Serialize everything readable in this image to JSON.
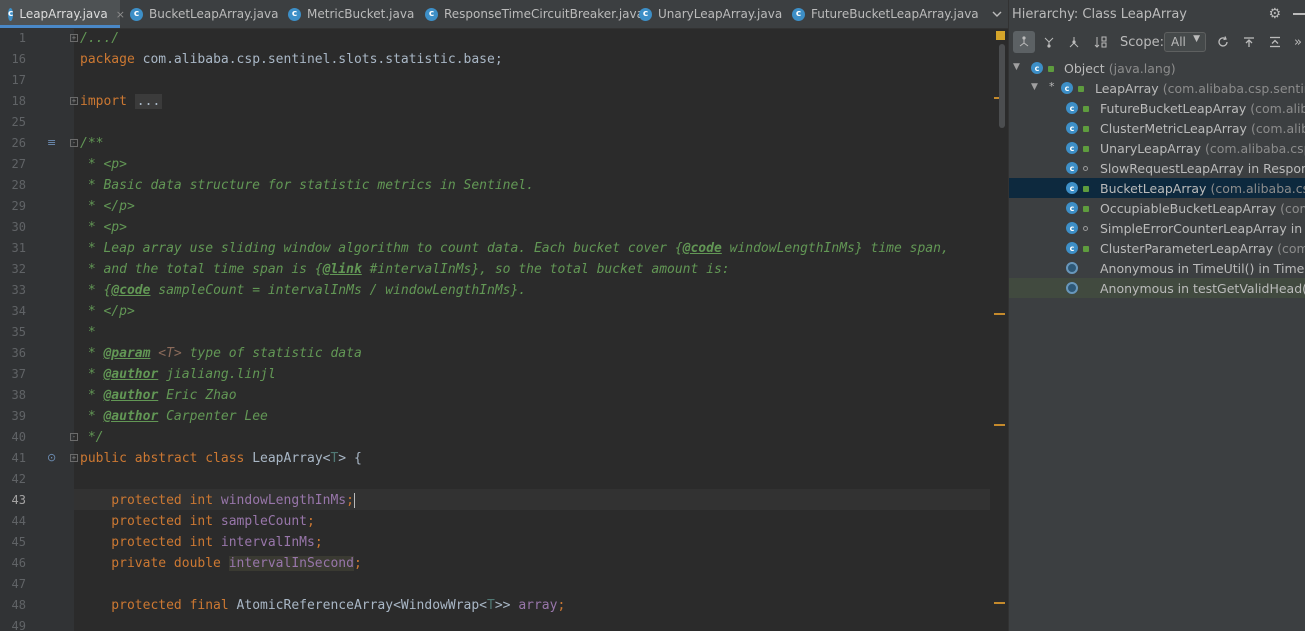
{
  "tabs": [
    {
      "label": "LeapArray.java",
      "active": true,
      "close": "×"
    },
    {
      "label": "BucketLeapArray.java",
      "active": false
    },
    {
      "label": "MetricBucket.java",
      "active": false
    },
    {
      "label": "ResponseTimeCircuitBreaker.java",
      "active": false
    },
    {
      "label": "UnaryLeapArray.java",
      "active": false
    },
    {
      "label": "FutureBucketLeapArray.java",
      "active": false
    }
  ],
  "tab_icon_letter": "c",
  "tab_overflow_icon": "chevron-down-icon",
  "editor": {
    "current_line": "43",
    "line_numbers": [
      "1",
      "16",
      "17",
      "18",
      "25",
      "26",
      "27",
      "28",
      "29",
      "30",
      "31",
      "32",
      "33",
      "34",
      "35",
      "36",
      "37",
      "38",
      "39",
      "40",
      "41",
      "42",
      "43",
      "44",
      "45",
      "46",
      "47",
      "48",
      "49"
    ],
    "code": {
      "l1": "/.../",
      "l16_kw": "package",
      "l16_rest": " com.alibaba.csp.sentinel.slots.statistic.base;",
      "l18_kw": "import",
      "l18_dots": "...",
      "l26": "/**",
      "l27": " * <p>",
      "l28": " * Basic data structure for statistic metrics in Sentinel.",
      "l29": " * </p>",
      "l30": " * <p>",
      "l31_a": " * Leap array use sliding window algorithm to count data. Each bucket cover {",
      "l31_tag": "@code",
      "l31_b": " windowLengthInMs} time span,",
      "l32_a": " * and the total time span is {",
      "l32_tag": "@link",
      "l32_b": " #intervalInMs}, so the total bucket amount is:",
      "l33_a": " * {",
      "l33_tag": "@code",
      "l33_b": " sampleCount = intervalInMs / windowLengthInMs}.",
      "l34": " * </p>",
      "l35": " *",
      "l36_a": " * ",
      "l36_tag": "@param",
      "l36_t": " <T>",
      "l36_b": " type of statistic data",
      "l37_a": " * ",
      "l37_tag": "@author",
      "l37_b": " jialiang.linjl",
      "l38_a": " * ",
      "l38_tag": "@author",
      "l38_b": " Eric Zhao",
      "l39_a": " * ",
      "l39_tag": "@author",
      "l39_b": " Carpenter Lee",
      "l40": " */",
      "l41_kw": "public abstract class",
      "l41_name": " LeapArray<",
      "l41_t": "T",
      "l41_end": "> {",
      "l43_kw": "    protected int",
      "l43_fd": " windowLengthInMs",
      "l43_end": ";",
      "l44_kw": "    protected int",
      "l44_fd": " sampleCount",
      "l44_end": ";",
      "l45_kw": "    protected int",
      "l45_fd": " intervalInMs",
      "l45_end": ";",
      "l46_kw": "    private double",
      "l46_fd": "intervalInSecond",
      "l46_end": ";",
      "l48_kw": "    protected final",
      "l48_a": " AtomicReferenceArray<WindowWrap<",
      "l48_t": "T",
      "l48_b": ">> ",
      "l48_fd": "array",
      "l48_end": ";"
    }
  },
  "hierarchy": {
    "title": "Hierarchy:  Class LeapArray",
    "scope_label": "Scope:",
    "scope_value": "All",
    "toolbar_icons": [
      "subtypes-hierarchy-icon",
      "supertypes-hierarchy-icon",
      "class-hierarchy-icon",
      "sort-alphabetically-icon",
      "refresh-icon",
      "export-icon",
      "collapse-all-icon",
      "more-icon"
    ],
    "nodes": [
      {
        "name": "Object",
        "pkg": "(java.lang)",
        "level": 0
      },
      {
        "name": "LeapArray",
        "pkg": "(com.alibaba.csp.sentinel",
        "level": 1
      },
      {
        "name": "FutureBucketLeapArray",
        "pkg": "(com.aliba",
        "level": 2
      },
      {
        "name": "ClusterMetricLeapArray",
        "pkg": "(com.aliba",
        "level": 2
      },
      {
        "name": "UnaryLeapArray",
        "pkg": "(com.alibaba.csp.s",
        "level": 2
      },
      {
        "name": "SlowRequestLeapArray in Response",
        "pkg": "",
        "level": 2
      },
      {
        "name": "BucketLeapArray",
        "pkg": "(com.alibaba.csp.",
        "level": 2
      },
      {
        "name": "OccupiableBucketLeapArray",
        "pkg": "(com.a",
        "level": 2
      },
      {
        "name": "SimpleErrorCounterLeapArray in Ex",
        "pkg": "",
        "level": 2
      },
      {
        "name": "ClusterParameterLeapArray",
        "pkg": "(com.a",
        "level": 2
      },
      {
        "name": "Anonymous in TimeUtil() in TimeUti",
        "pkg": "",
        "level": 2
      },
      {
        "name": "Anonymous in testGetValidHead() in",
        "pkg": "",
        "level": 2
      }
    ],
    "class_icon_letter": "c",
    "expand_arrow": "▼",
    "star": "*"
  }
}
